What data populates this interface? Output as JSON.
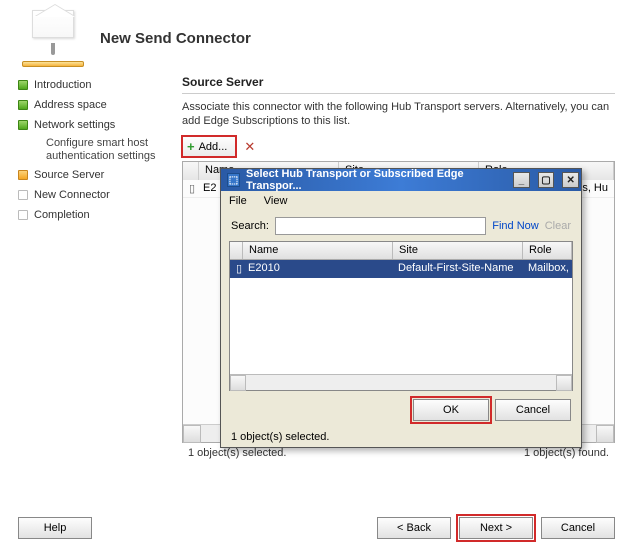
{
  "header": {
    "title": "New Send Connector"
  },
  "nav": {
    "items": [
      {
        "label": "Introduction",
        "state": "green"
      },
      {
        "label": "Address space",
        "state": "green"
      },
      {
        "label": "Network settings",
        "state": "green"
      },
      {
        "label": "Configure smart host authentication settings",
        "sub": true
      },
      {
        "label": "Source Server",
        "state": "orange"
      },
      {
        "label": "New Connector",
        "state": "grey"
      },
      {
        "label": "Completion",
        "state": "grey"
      }
    ]
  },
  "section": {
    "title": "Source Server",
    "instruction": "Associate this connector with the following Hub Transport servers. Alternatively, you can add Edge Subscriptions to this list.",
    "add_label": "Add...",
    "remove_tooltip": "Remove",
    "columns": [
      "Name",
      "Site",
      "Role"
    ],
    "row_name": "E2",
    "row_role_fragment": "ess, Hu",
    "status_left": "1 object(s) selected.",
    "status_right": "1 object(s) found."
  },
  "dialog": {
    "title": "Select Hub Transport or Subscribed Edge Transpor...",
    "menu_file": "File",
    "menu_view": "View",
    "search_label": "Search:",
    "find_label": "Find Now",
    "clear_label": "Clear",
    "columns": [
      "Name",
      "Site",
      "Role"
    ],
    "row": {
      "name": "E2010",
      "site": "Default-First-Site-Name",
      "role": "Mailbox, Clie"
    },
    "ok_label": "OK",
    "cancel_label": "Cancel",
    "status": "1 object(s) selected."
  },
  "wizard": {
    "help_label": "Help",
    "back_label": "< Back",
    "next_label": "Next >",
    "cancel_label": "Cancel"
  }
}
